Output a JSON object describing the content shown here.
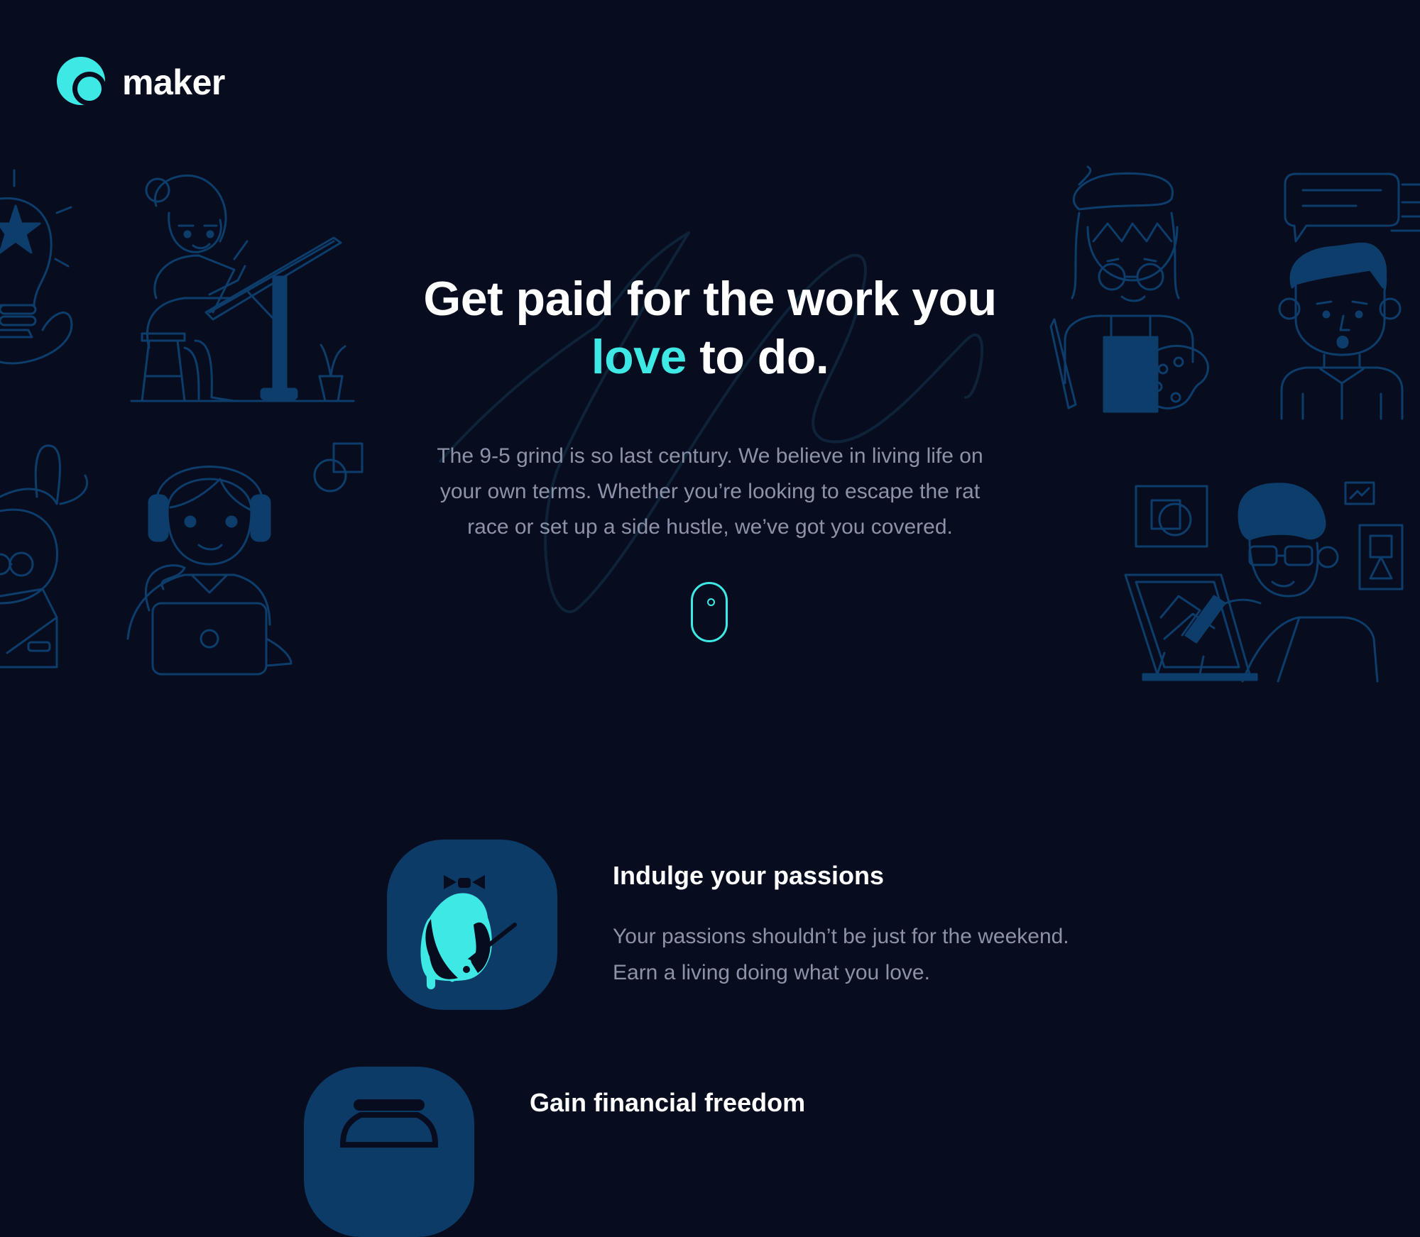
{
  "brand": {
    "name": "maker",
    "accent_color": "#3ee9e5",
    "background_color": "#070c1f"
  },
  "hero": {
    "headline_part1": "Get paid for the work you",
    "headline_accent": "love",
    "headline_part2": "to do.",
    "lead": "The 9-5 grind is so last century. We believe in living life on your own terms. Whether you’re looking to escape the rat race or set up a side hustle, we’ve got you covered.",
    "scroll_icon": "mouse-scroll-icon"
  },
  "features": [
    {
      "icon": "paint-palette-icon",
      "title": "Indulge your passions",
      "text_line1": "Your passions shouldn’t be just for the weekend.",
      "text_line2": "Earn a living doing what you love."
    },
    {
      "icon": "money-jar-icon",
      "title": "Gain financial freedom"
    }
  ]
}
